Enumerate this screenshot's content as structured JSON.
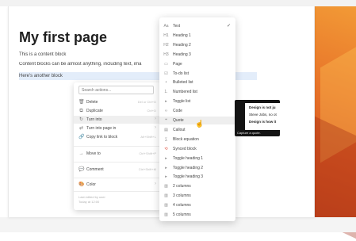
{
  "page": {
    "title": "My first page",
    "blocks": [
      "This is a content block",
      "Content blocks can be almost anything, including text, ima",
      "Here's another block"
    ]
  },
  "context_menu": {
    "search_placeholder": "Search actions...",
    "items": [
      {
        "icon": "🗑",
        "icon_name": "trash-icon",
        "label": "Delete",
        "shortcut": "Del or Ctrl+D"
      },
      {
        "icon": "⧉",
        "icon_name": "duplicate-icon",
        "label": "Duplicate",
        "shortcut": "Ctrl+D"
      },
      {
        "icon": "↻",
        "icon_name": "turn-into-icon",
        "label": "Turn into",
        "shortcut": "›"
      },
      {
        "icon": "⇄",
        "icon_name": "page-icon",
        "label": "Turn into page in",
        "shortcut": "›"
      },
      {
        "icon": "🔗",
        "icon_name": "link-icon",
        "label": "Copy link to block",
        "shortcut": "Alt+Shift+L"
      },
      {
        "icon": "→",
        "icon_name": "move-icon",
        "label": "Move to",
        "shortcut": "Ctrl+Shift+P"
      },
      {
        "icon": "💬",
        "icon_name": "comment-icon",
        "label": "Comment",
        "shortcut": "Ctrl+Shift+M"
      },
      {
        "icon": "🎨",
        "icon_name": "color-icon",
        "label": "Color",
        "shortcut": "›"
      }
    ],
    "footer_line1": "Last edited by user",
    "footer_line2": "Today at 12:00"
  },
  "type_menu": {
    "items": [
      {
        "icon": "Aa",
        "icon_name": "text-icon",
        "label": "Text",
        "checked": true
      },
      {
        "icon": "H1",
        "icon_name": "heading1-icon",
        "label": "Heading 1"
      },
      {
        "icon": "H2",
        "icon_name": "heading2-icon",
        "label": "Heading 2"
      },
      {
        "icon": "H3",
        "icon_name": "heading3-icon",
        "label": "Heading 3"
      },
      {
        "icon": "▭",
        "icon_name": "page-icon",
        "label": "Page"
      },
      {
        "icon": "☑",
        "icon_name": "todo-icon",
        "label": "To-do list"
      },
      {
        "icon": "•",
        "icon_name": "bulleted-list-icon",
        "label": "Bulleted list"
      },
      {
        "icon": "1.",
        "icon_name": "numbered-list-icon",
        "label": "Numbered list"
      },
      {
        "icon": "▸",
        "icon_name": "toggle-list-icon",
        "label": "Toggle list"
      },
      {
        "icon": "‹›",
        "icon_name": "code-icon",
        "label": "Code"
      },
      {
        "icon": "❝",
        "icon_name": "quote-icon",
        "label": "Quote"
      },
      {
        "icon": "▤",
        "icon_name": "callout-icon",
        "label": "Callout"
      },
      {
        "icon": "∑",
        "icon_name": "equation-icon",
        "label": "Block equation"
      },
      {
        "icon": "⟲",
        "icon_name": "synced-block-icon",
        "label": "Synced block"
      },
      {
        "icon": "▸",
        "icon_name": "toggle-heading1-icon",
        "label": "Toggle heading 1"
      },
      {
        "icon": "▸",
        "icon_name": "toggle-heading2-icon",
        "label": "Toggle heading 2"
      },
      {
        "icon": "▸",
        "icon_name": "toggle-heading3-icon",
        "label": "Toggle heading 3"
      },
      {
        "icon": "▥",
        "icon_name": "two-columns-icon",
        "label": "2 columns"
      },
      {
        "icon": "▥",
        "icon_name": "three-columns-icon",
        "label": "3 columns"
      },
      {
        "icon": "▥",
        "icon_name": "four-columns-icon",
        "label": "4 columns"
      },
      {
        "icon": "▥",
        "icon_name": "five-columns-icon",
        "label": "5 columns"
      }
    ]
  },
  "preview": {
    "lines": [
      "Design is not ju",
      "Steve Jobs, no ot",
      "Design is how it"
    ],
    "caption": "Capture a quote."
  },
  "colors": {
    "selection": "#e3edfa",
    "desktop_accent": "#e8752a"
  }
}
